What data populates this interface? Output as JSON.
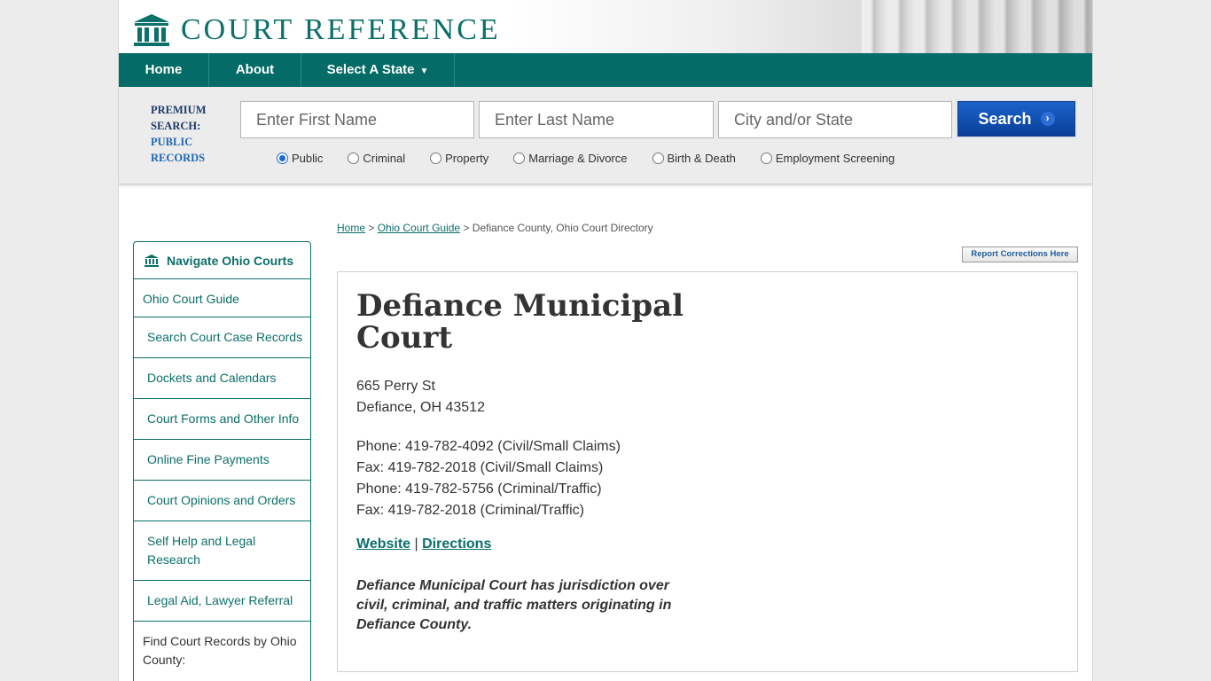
{
  "header": {
    "logo_text": "COURT REFERENCE"
  },
  "nav": {
    "home": "Home",
    "about": "About",
    "select_state": "Select A State"
  },
  "search": {
    "premium_label": "PREMIUM SEARCH:",
    "premium_sub": "PUBLIC RECORDS",
    "first_name_placeholder": "Enter First Name",
    "last_name_placeholder": "Enter Last Name",
    "city_placeholder": "City and/or State",
    "button_label": "Search",
    "options": [
      {
        "label": "Public",
        "selected": true
      },
      {
        "label": "Criminal",
        "selected": false
      },
      {
        "label": "Property",
        "selected": false
      },
      {
        "label": "Marriage & Divorce",
        "selected": false
      },
      {
        "label": "Birth & Death",
        "selected": false
      },
      {
        "label": "Employment Screening",
        "selected": false
      }
    ]
  },
  "breadcrumb": {
    "home": "Home",
    "sep1": " > ",
    "guide": "Ohio Court Guide",
    "sep2": " > ",
    "current": "Defiance County, Ohio Court Directory"
  },
  "report_button": "Report Corrections Here",
  "sidebar": {
    "title": "Navigate Ohio Courts",
    "items": [
      "Ohio Court Guide",
      "Search Court Case Records",
      "Dockets and Calendars",
      "Court Forms and Other Info",
      "Online Fine Payments",
      "Court Opinions and Orders",
      "Self Help and Legal Research",
      "Legal Aid, Lawyer Referral"
    ],
    "find_by_county": "Find Court Records by Ohio County:"
  },
  "court": {
    "name": "Defiance Municipal Court",
    "address_line1": "665 Perry St",
    "address_line2": "Defiance, OH 43512",
    "phone1": "Phone: 419-782-4092 (Civil/Small Claims)",
    "fax1": "Fax: 419-782-2018 (Civil/Small Claims)",
    "phone2": "Phone: 419-782-5756 (Criminal/Traffic)",
    "fax2": "Fax: 419-782-2018 (Criminal/Traffic)",
    "website_link": "Website",
    "link_separator": " | ",
    "directions_link": "Directions",
    "description": "Defiance Municipal Court has jurisdiction over civil, criminal, and traffic matters originating in Defiance County."
  },
  "colors": {
    "brand_teal": "#046b66",
    "search_blue": "#0a3f9a"
  }
}
